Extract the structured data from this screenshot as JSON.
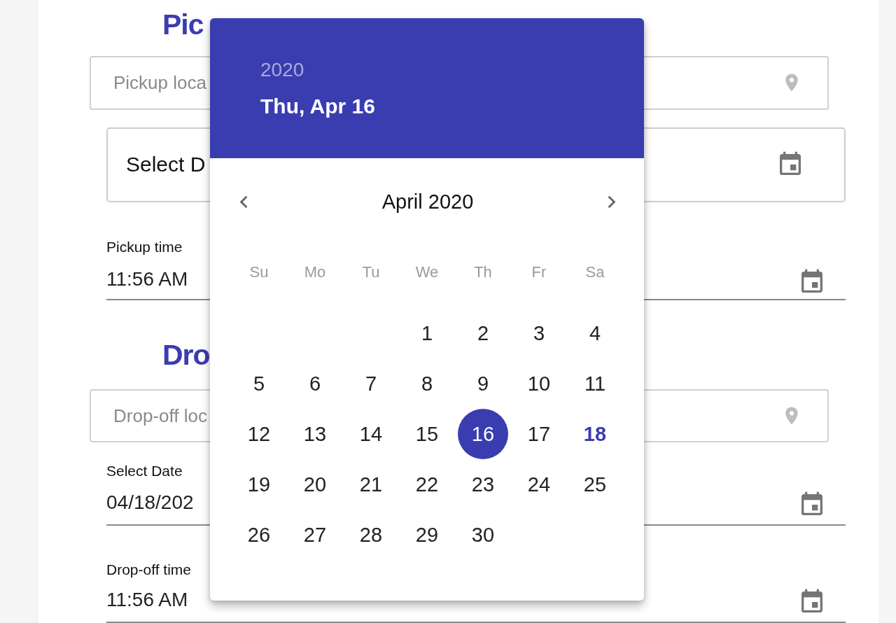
{
  "pickup": {
    "heading": "Pic",
    "location": {
      "placeholder": "Pickup loca"
    },
    "date": {
      "value": "Select D"
    },
    "time": {
      "label": "Pickup time",
      "value": "11:56 AM"
    }
  },
  "dropoff": {
    "heading": "Dro",
    "location": {
      "placeholder": "Drop-off loc"
    },
    "date": {
      "label": "Select Date",
      "value": "04/18/202"
    },
    "time": {
      "label": "Drop-off time",
      "value": "11:56 AM"
    }
  },
  "date_picker": {
    "year": "2020",
    "date": "Thu, Apr 16",
    "month": "April 2020",
    "weekdays": [
      "Su",
      "Mo",
      "Tu",
      "We",
      "Th",
      "Fr",
      "Sa"
    ],
    "weeks": [
      [
        {
          "label": "1",
          "selected": false,
          "today": false
        },
        {
          "label": "2",
          "selected": false,
          "today": false
        },
        {
          "label": "3",
          "selected": false,
          "today": false
        },
        {
          "label": "4",
          "selected": false,
          "today": false
        }
      ],
      [
        {
          "label": "5",
          "selected": false,
          "today": false
        },
        {
          "label": "6",
          "selected": false,
          "today": false
        },
        {
          "label": "7",
          "selected": false,
          "today": false
        },
        {
          "label": "8",
          "selected": false,
          "today": false
        },
        {
          "label": "9",
          "selected": false,
          "today": false
        },
        {
          "label": "10",
          "selected": false,
          "today": false
        },
        {
          "label": "11",
          "selected": false,
          "today": false
        }
      ],
      [
        {
          "label": "12",
          "selected": false,
          "today": false
        },
        {
          "label": "13",
          "selected": false,
          "today": false
        },
        {
          "label": "14",
          "selected": false,
          "today": false
        },
        {
          "label": "15",
          "selected": false,
          "today": false
        },
        {
          "label": "16",
          "selected": true,
          "today": false
        },
        {
          "label": "17",
          "selected": false,
          "today": false
        },
        {
          "label": "18",
          "selected": false,
          "today": true
        }
      ],
      [
        {
          "label": "19",
          "selected": false,
          "today": false
        },
        {
          "label": "20",
          "selected": false,
          "today": false
        },
        {
          "label": "21",
          "selected": false,
          "today": false
        },
        {
          "label": "22",
          "selected": false,
          "today": false
        },
        {
          "label": "23",
          "selected": false,
          "today": false
        },
        {
          "label": "24",
          "selected": false,
          "today": false
        },
        {
          "label": "25",
          "selected": false,
          "today": false
        }
      ],
      [
        {
          "label": "26",
          "selected": false,
          "today": false
        },
        {
          "label": "27",
          "selected": false,
          "today": false
        },
        {
          "label": "28",
          "selected": false,
          "today": false
        },
        {
          "label": "29",
          "selected": false,
          "today": false
        },
        {
          "label": "30",
          "selected": false,
          "today": false
        }
      ]
    ]
  }
}
